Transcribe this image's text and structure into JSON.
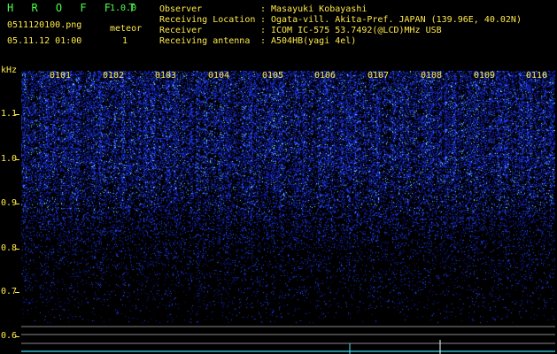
{
  "header": {
    "app_title": "H R O F F T",
    "app_version": "1.0.0",
    "file_name": "0511120100.png",
    "meteor_label": "meteor",
    "meteor_count": "1",
    "datetime": "05.11.12 01:00"
  },
  "info": [
    {
      "key": "Observer",
      "value": "Masayuki Kobayashi"
    },
    {
      "key": "Receiving Location",
      "value": "Ogata-vill. Akita-Pref. JAPAN (139.96E, 40.02N)"
    },
    {
      "key": "Receiver",
      "value": "ICOM IC-575 53.7492(@LCD)MHz USB"
    },
    {
      "key": "Receiving antenna",
      "value": "A504HB(yagi 4el)"
    }
  ],
  "separator": ":",
  "axis": {
    "y_unit": "kHz",
    "y_ticks": [
      "1.1",
      "1.0",
      "0.9",
      "0.8",
      "0.7",
      "0.6"
    ],
    "time_ticks": [
      "0101",
      "0102",
      "0103",
      "0104",
      "0105",
      "0106",
      "0107",
      "0108",
      "0109",
      "0110"
    ]
  },
  "colors": {
    "label_yellow": "#ffe94a",
    "title_green": "#4cff4c",
    "spectrogram_bg": "#000000",
    "signal_blue": "#2a4dff",
    "signal_cyan": "#4fe0ff"
  }
}
